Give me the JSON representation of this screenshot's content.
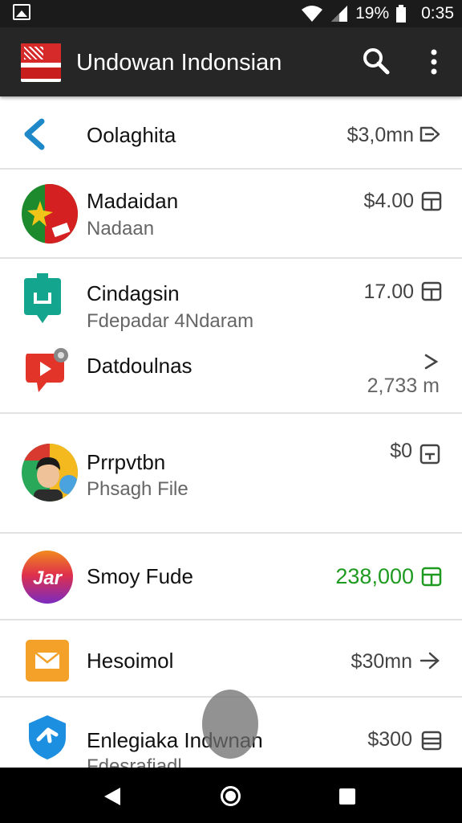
{
  "status_bar": {
    "battery": "19%",
    "time": "0:35"
  },
  "app_bar": {
    "title": "Undowan Indonsian"
  },
  "colors": {
    "app_bar": "#262626",
    "status_bar": "#1b1b1b",
    "accent_blue": "#1e88c8",
    "positive_green": "#1f9a20",
    "divider": "#e2e2e2"
  },
  "rows": [
    {
      "name": "Oolaghita",
      "amount": "$3,0mn",
      "icon": "back-chevron-icon",
      "trail_icon": "arrow-right-outline-icon"
    },
    {
      "name": "Madaidan",
      "subtitle": "Nadaan",
      "amount": "$4.00",
      "icon": "flag-avatar-icon",
      "trail_icon": "calendar-icon"
    },
    {
      "name": "Cindagsin",
      "subtitle": "Fdepadar 4Ndaram",
      "amount": "17.00",
      "icon": "teal-bag-icon",
      "trail_icon": "calendar-icon"
    },
    {
      "name": "Datdoulnas",
      "amount": "2,733 m",
      "icon": "red-play-icon",
      "trail_icon": "chevron-right-icon"
    },
    {
      "name": "Prrpvtbn",
      "subtitle": "Phsagh File",
      "amount": "$0",
      "icon": "child-avatar-icon",
      "trail_icon": "edit-box-icon"
    },
    {
      "name": "Smoy Fude",
      "amount": "238,000",
      "icon": "gradient-logo-icon",
      "trail_icon": "calendar-icon"
    },
    {
      "name": "Hesoimol",
      "amount": "$30mn",
      "icon": "mail-icon",
      "trail_icon": "arrow-right-icon"
    },
    {
      "name": "Enlegiaka Indwnan",
      "subtitle": "Fdesrafiadl",
      "amount": "$300",
      "icon": "blue-shield-icon",
      "trail_icon": "calendar-icon"
    }
  ],
  "nav_bar": {
    "back_icon": "back-triangle-icon",
    "home_icon": "home-circle-icon",
    "recents_icon": "recents-square-icon"
  }
}
